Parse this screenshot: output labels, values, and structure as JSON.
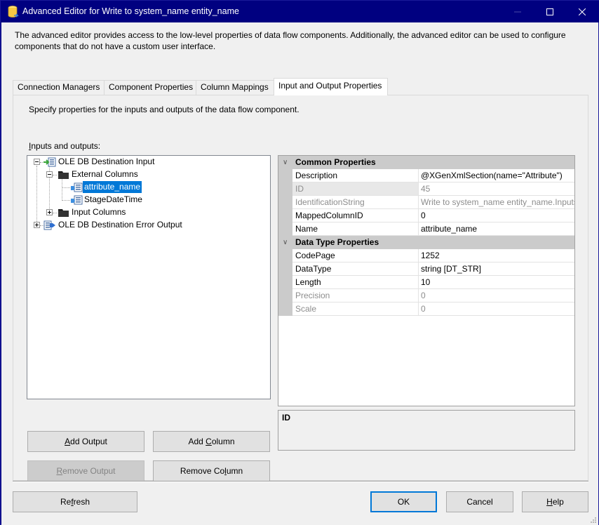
{
  "window": {
    "title": "Advanced Editor for Write to system_name entity_name",
    "app_icon": "database-cylinder-icon",
    "controls": {
      "minimize": "minimize-icon",
      "maximize": "maximize-icon",
      "close": "close-icon"
    }
  },
  "description": "The advanced editor provides access to the low-level properties of data flow components. Additionally, the advanced editor can be used to configure components that do not have a custom user interface.",
  "tabs": [
    {
      "label": "Connection Managers",
      "active": false
    },
    {
      "label": "Component Properties",
      "active": false
    },
    {
      "label": "Column Mappings",
      "active": false
    },
    {
      "label": "Input and Output Properties",
      "active": true
    }
  ],
  "panel": {
    "description": "Specify properties for the inputs and outputs of the data flow component.",
    "io_label_mnemonic": "I",
    "io_label_rest": "nputs and outputs:"
  },
  "tree": [
    {
      "label": "OLE DB Destination Input",
      "icon": "input-icon",
      "expanded": true,
      "level": 0
    },
    {
      "label": "External Columns",
      "icon": "folder-icon",
      "expanded": true,
      "level": 1
    },
    {
      "label": "attribute_name",
      "icon": "column-icon",
      "level": 2,
      "selected": true
    },
    {
      "label": "StageDateTime",
      "icon": "column-icon",
      "level": 2
    },
    {
      "label": "Input Columns",
      "icon": "folder-icon",
      "expanded": false,
      "level": 1
    },
    {
      "label": "OLE DB Destination Error Output",
      "icon": "output-icon",
      "expanded": false,
      "level": 0
    }
  ],
  "properties": {
    "categories": [
      {
        "name": "Common Properties",
        "rows": [
          {
            "name": "Description",
            "value": "@XGenXmlSection(name=\"Attribute\")",
            "readonly": false
          },
          {
            "name": "ID",
            "value": "45",
            "readonly": true
          },
          {
            "name": "IdentificationString",
            "value": "Write to system_name entity_name.Inputs[OLE DB Destination Input].ExternalColumns[attribute_name]",
            "readonly": true
          },
          {
            "name": "MappedColumnID",
            "value": "0",
            "readonly": false
          },
          {
            "name": "Name",
            "value": "attribute_name",
            "readonly": false
          }
        ]
      },
      {
        "name": "Data Type Properties",
        "rows": [
          {
            "name": "CodePage",
            "value": "1252",
            "readonly": false
          },
          {
            "name": "DataType",
            "value": "string [DT_STR]",
            "readonly": false
          },
          {
            "name": "Length",
            "value": "10",
            "readonly": false
          },
          {
            "name": "Precision",
            "value": "0",
            "readonly": true
          },
          {
            "name": "Scale",
            "value": "0",
            "readonly": true
          }
        ]
      }
    ],
    "help_title": "ID"
  },
  "buttons": {
    "add_output": {
      "pre": "",
      "key": "A",
      "post": "dd Output",
      "enabled": true
    },
    "add_column": {
      "pre": "Add ",
      "key": "C",
      "post": "olumn",
      "enabled": true
    },
    "remove_output": {
      "pre": "",
      "key": "R",
      "post": "emove Output",
      "enabled": false
    },
    "remove_column": {
      "pre": "Remove Co",
      "key": "l",
      "post": "umn",
      "enabled": true
    },
    "refresh": {
      "pre": "Re",
      "key": "f",
      "post": "resh"
    },
    "ok": {
      "label": "OK"
    },
    "cancel": {
      "label": "Cancel"
    },
    "help": {
      "pre": "",
      "key": "H",
      "post": "elp"
    }
  },
  "colors": {
    "titlebar": "#000080",
    "selection": "#0078d7",
    "category_bg": "#cbcbcb",
    "readonly_text": "#8d8d8d"
  }
}
